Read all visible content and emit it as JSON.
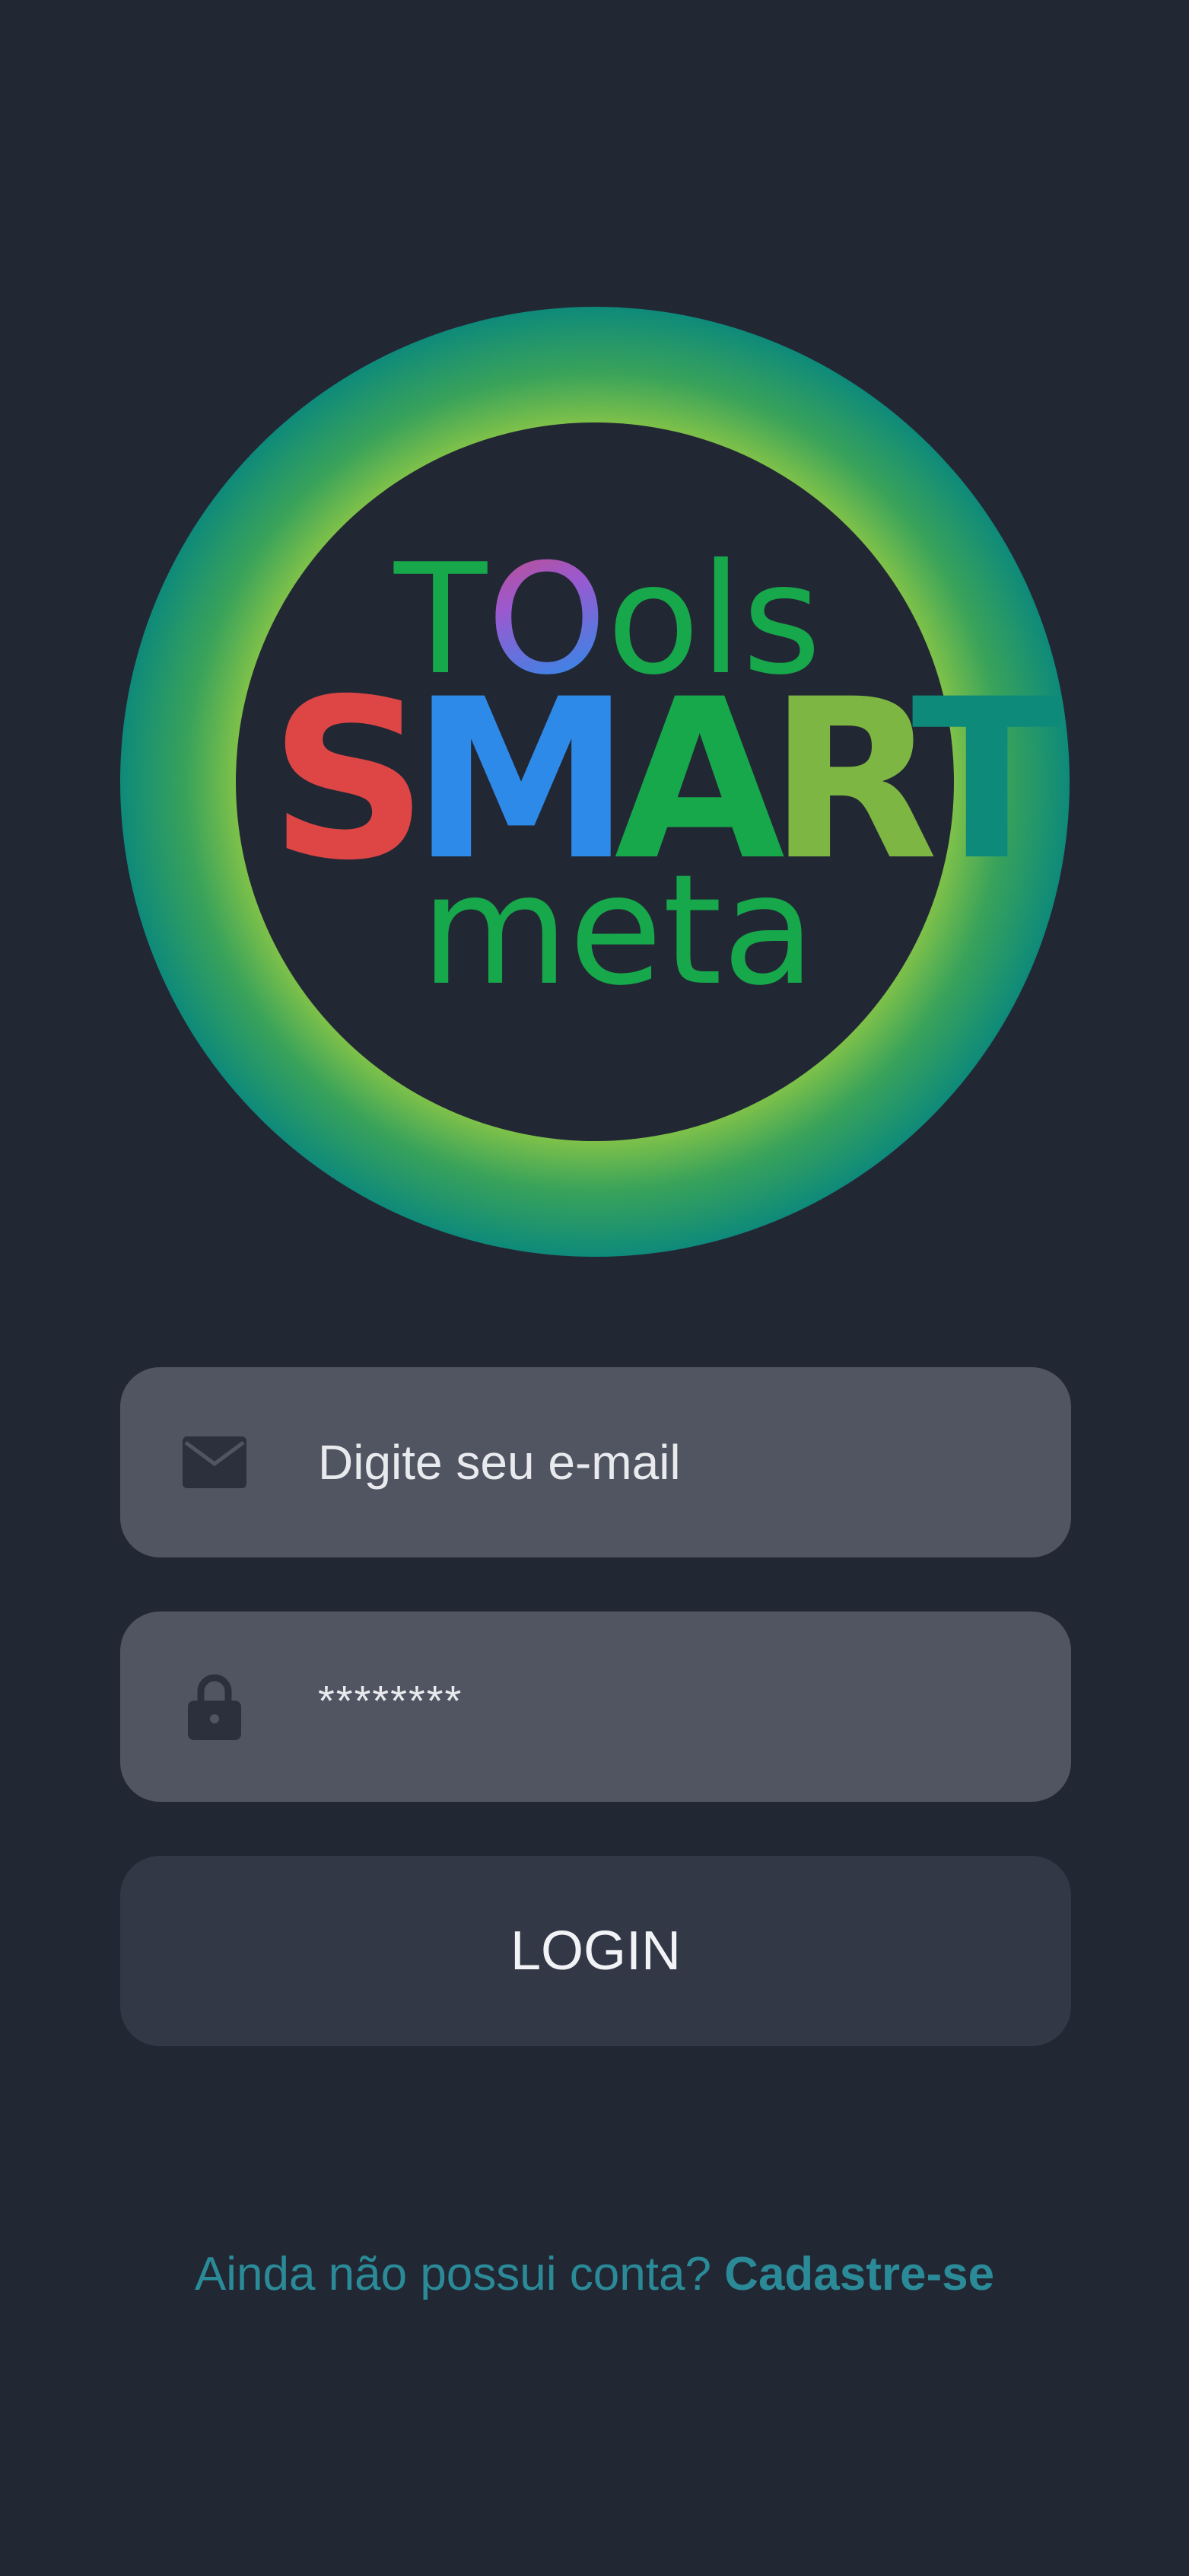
{
  "logo": {
    "line1_prefix": "T",
    "line1_o": "O",
    "line1_suffix": "ols",
    "line2_s": "S",
    "line2_m": "M",
    "line2_a": "A",
    "line2_r": "R",
    "line2_t": "T",
    "line3": "meta",
    "colors": {
      "ring_outer": "#0e8a7a",
      "ring_inner": "#7cc04a",
      "tools": "#16a84a",
      "s": "#de4646",
      "m": "#2e8ae8",
      "a": "#16a84a",
      "r": "#7db642",
      "t": "#0e8a7a"
    }
  },
  "email_field": {
    "icon": "envelope-icon",
    "placeholder": "Digite seu e-mail"
  },
  "password_field": {
    "icon": "lock-icon",
    "value": "********"
  },
  "login_button": {
    "label": "LOGIN"
  },
  "signup": {
    "prompt": "Ainda não possui conta?",
    "link": "Cadastre-se"
  },
  "colors": {
    "background": "#222734",
    "field_bg": "#515461",
    "button_bg": "#333846",
    "link": "#2b8a97"
  }
}
